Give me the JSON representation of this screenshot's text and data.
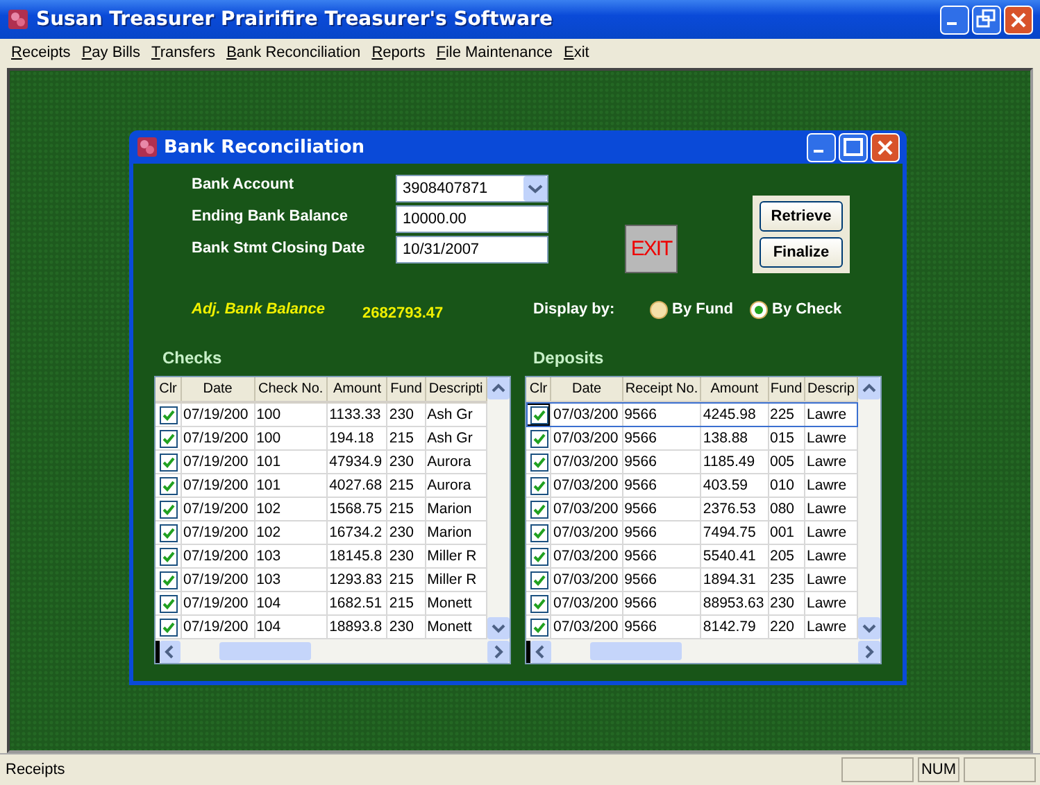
{
  "window": {
    "title": "Susan Treasurer Prairifire Treasurer's Software"
  },
  "menu": [
    "Receipts",
    "Pay Bills",
    "Transfers",
    "Bank Reconciliation",
    "Reports",
    "File Maintenance",
    "Exit"
  ],
  "dialog": {
    "title": "Bank Reconciliation",
    "fields": [
      {
        "label": "Bank Account",
        "value": "3908407871",
        "kind": "dropdown"
      },
      {
        "label": "Ending Bank Balance",
        "value": "10000.00",
        "kind": "text"
      },
      {
        "label": "Bank Stmt Closing Date",
        "value": "10/31/2007",
        "kind": "text"
      }
    ],
    "exit_label": "EXIT",
    "buttons": [
      "Retrieve",
      "Finalize"
    ],
    "adj_balance": {
      "label": "Adj. Bank Balance",
      "value": "2682793.47"
    },
    "display_by": {
      "label": "Display by:",
      "options": [
        {
          "label": "By Fund",
          "selected": false
        },
        {
          "label": "By Check",
          "selected": true
        }
      ]
    },
    "checks": {
      "title": "Checks",
      "columns": [
        "Clr",
        "Date",
        "Check No.",
        "Amount",
        "Fund",
        "Descripti"
      ],
      "rows": [
        {
          "selected": false,
          "cells": [
            {
              "checked": true
            },
            "07/19/200",
            "100",
            "1133.33",
            "230",
            "Ash Gr"
          ]
        },
        {
          "selected": false,
          "cells": [
            {
              "checked": true
            },
            "07/19/200",
            "100",
            "194.18",
            "215",
            "Ash Gr"
          ]
        },
        {
          "selected": false,
          "cells": [
            {
              "checked": true
            },
            "07/19/200",
            "101",
            "47934.9",
            "230",
            "Aurora"
          ]
        },
        {
          "selected": false,
          "cells": [
            {
              "checked": true
            },
            "07/19/200",
            "101",
            "4027.68",
            "215",
            "Aurora"
          ]
        },
        {
          "selected": false,
          "cells": [
            {
              "checked": true
            },
            "07/19/200",
            "102",
            "1568.75",
            "215",
            "Marion"
          ]
        },
        {
          "selected": false,
          "cells": [
            {
              "checked": true
            },
            "07/19/200",
            "102",
            "16734.2",
            "230",
            "Marion"
          ]
        },
        {
          "selected": false,
          "cells": [
            {
              "checked": true
            },
            "07/19/200",
            "103",
            "18145.8",
            "230",
            "Miller R"
          ]
        },
        {
          "selected": false,
          "cells": [
            {
              "checked": true
            },
            "07/19/200",
            "103",
            "1293.83",
            "215",
            "Miller R"
          ]
        },
        {
          "selected": false,
          "cells": [
            {
              "checked": true
            },
            "07/19/200",
            "104",
            "1682.51",
            "215",
            "Monett"
          ]
        },
        {
          "selected": false,
          "cells": [
            {
              "checked": true
            },
            "07/19/200",
            "104",
            "18893.8",
            "230",
            "Monett"
          ]
        }
      ]
    },
    "deposits": {
      "title": "Deposits",
      "columns": [
        "Clr",
        "Date",
        "Receipt No.",
        "Amount",
        "Fund",
        "Descrip"
      ],
      "rows": [
        {
          "selected": true,
          "cells": [
            {
              "checked": true
            },
            "07/03/200",
            "9566",
            "4245.98",
            "225",
            "Lawre"
          ]
        },
        {
          "selected": false,
          "cells": [
            {
              "checked": true
            },
            "07/03/200",
            "9566",
            "138.88",
            "015",
            "Lawre"
          ]
        },
        {
          "selected": false,
          "cells": [
            {
              "checked": true
            },
            "07/03/200",
            "9566",
            "1185.49",
            "005",
            "Lawre"
          ]
        },
        {
          "selected": false,
          "cells": [
            {
              "checked": true
            },
            "07/03/200",
            "9566",
            "403.59",
            "010",
            "Lawre"
          ]
        },
        {
          "selected": false,
          "cells": [
            {
              "checked": true
            },
            "07/03/200",
            "9566",
            "2376.53",
            "080",
            "Lawre"
          ]
        },
        {
          "selected": false,
          "cells": [
            {
              "checked": true
            },
            "07/03/200",
            "9566",
            "7494.75",
            "001",
            "Lawre"
          ]
        },
        {
          "selected": false,
          "cells": [
            {
              "checked": true
            },
            "07/03/200",
            "9566",
            "5540.41",
            "205",
            "Lawre"
          ]
        },
        {
          "selected": false,
          "cells": [
            {
              "checked": true
            },
            "07/03/200",
            "9566",
            "1894.31",
            "235",
            "Lawre"
          ]
        },
        {
          "selected": false,
          "cells": [
            {
              "checked": true
            },
            "07/03/200",
            "9566",
            "88953.63",
            "230",
            "Lawre"
          ]
        },
        {
          "selected": false,
          "cells": [
            {
              "checked": true
            },
            "07/03/200",
            "9566",
            "8142.79",
            "220",
            "Lawre"
          ]
        }
      ]
    }
  },
  "status_bar": {
    "text": "Receipts",
    "indicator": "NUM"
  }
}
